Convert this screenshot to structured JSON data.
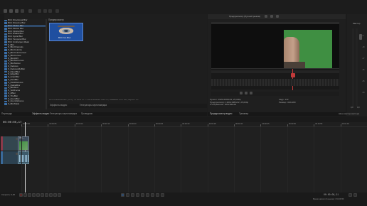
{
  "media_fx": {
    "items": [
      "BCC Directional Blur",
      "BCC Dissolve Blur",
      "BCC Flicker Blur",
      "BCC Motion Blur",
      "BCC Optical Blur",
      "BCC Radial Blur",
      "BCC Spiral Blur",
      "BCC Temporal Blur",
      "BCC Unsharpen Mask",
      "S_Blur",
      "S_BlurChannels",
      "S_BlurColorize",
      "S_BlurColorCorrect",
      "S_BlurCurves",
      "S_BlurHSV",
      "S_BlurMoCurves",
      "S_BlurMotion",
      "S_Defocus",
      "S_DefocusMoBlur",
      "S_DirectBlur",
      "S_EdgeBlur",
      "S_GrainBlur",
      "S_RectBlur",
      "S_RackDefocus",
      "S_RadialBlur",
      "S_BlurRed",
      "S_SoftFocus",
      "S_ZBlur",
      "S_TheBlur",
      "S_ZoomBlur",
      "S_ZoomDefocus",
      "S_BlurMask"
    ],
    "selected_index": 2,
    "preview_header": "Предпросмотр",
    "preview_caption": "BCC Ion Blur",
    "status_text": "BCC Directional Blur: (OFX), V1 Boris FX — Расположение: Boris FX, Название: BCC Blur, Версия: 9.0",
    "tabs": [
      "Эффекты видео",
      "Генераторы мультимедиа"
    ],
    "bottom_tabs": [
      "Переходы",
      "Эффекты видео",
      "Генераторы мультимедиа",
      "Проводник"
    ]
  },
  "preview": {
    "title": "Предпросмотр (Лучший режим)",
    "info": [
      [
        "Проект:",
        "1920x1080x32, 25,000p"
      ],
      [
        "Предпросмотр:",
        "1920x1080x32, 25,000p"
      ],
      [
        "Отображение:",
        "320x180x32"
      ]
    ],
    "info_right": [
      [
        "Кадр:",
        "142"
      ],
      [
        "Размер:",
        "320x180"
      ]
    ],
    "tabs": [
      "Предпросмотр видео",
      "Триммер"
    ]
  },
  "master": {
    "title": "Мастер",
    "levels": [
      -9,
      -18,
      -27,
      -36,
      -45,
      -54
    ],
    "label_left": "0,0",
    "label_right": "0,0",
    "bottom_label": "Шина мастер-мастера"
  },
  "timeline": {
    "timecode": "00:00:05,17",
    "ruler": [
      "00:00:00",
      "00:00:05",
      "00:00:10",
      "00:00:15",
      "00:00:20",
      "00:00:25",
      "00:00:30",
      "00:00:35",
      "00:00:40",
      "00:00:45",
      "00:00:50",
      "00:00:55",
      "00:01:00"
    ],
    "clip_label": "VID_...",
    "rate": "Скорость: 0,00",
    "end_time": "00:00:06,21",
    "record_time": "Время записи (2 канала): 1:54:06:56"
  }
}
